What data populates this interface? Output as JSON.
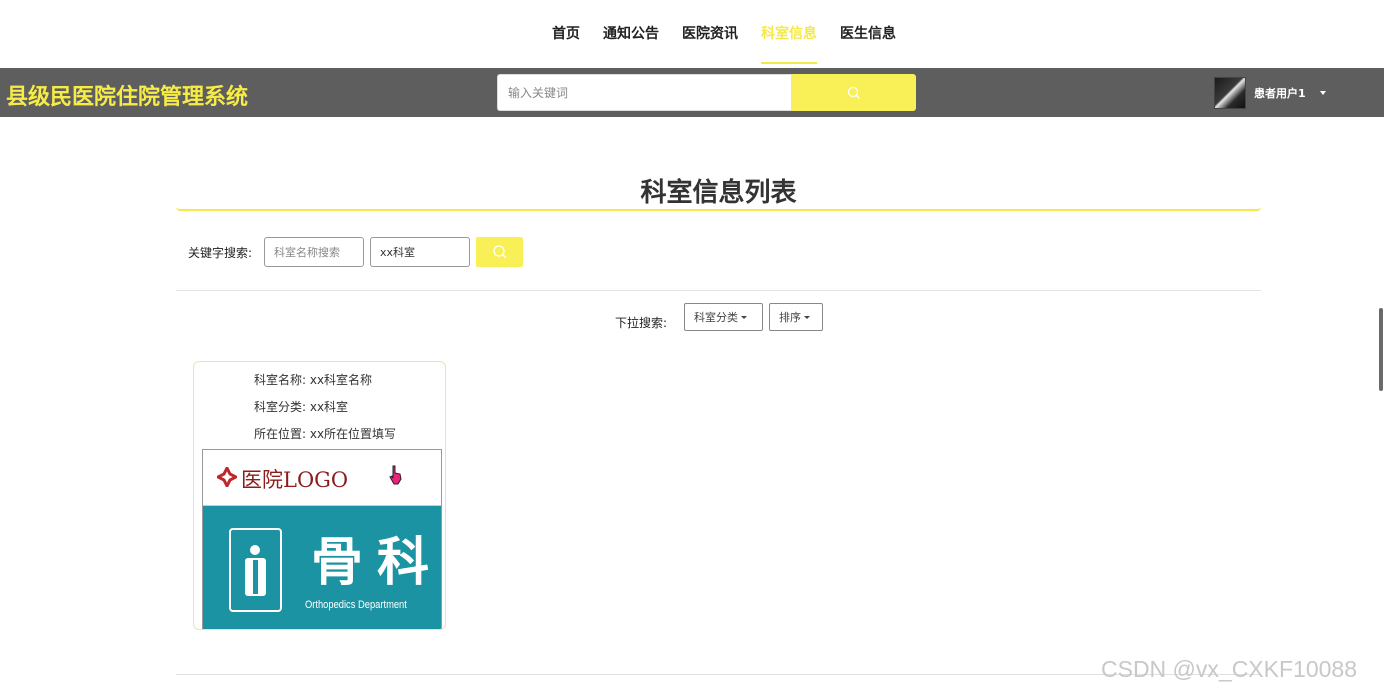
{
  "nav": {
    "items": [
      {
        "label": "首页",
        "active": false
      },
      {
        "label": "通知公告",
        "active": false
      },
      {
        "label": "医院资讯",
        "active": false
      },
      {
        "label": "科室信息",
        "active": true
      },
      {
        "label": "医生信息",
        "active": false
      }
    ]
  },
  "header": {
    "brand": "县级民医院住院管理系统",
    "search_placeholder": "输入关键词",
    "user_name": "患者用户1"
  },
  "page": {
    "title": "科室信息列表"
  },
  "keyword_search": {
    "label": "关键字搜索:",
    "name_placeholder": "科室名称搜索",
    "category_value": "xx科室"
  },
  "dropdown_search": {
    "label": "下拉搜索:",
    "category_button": "科室分类",
    "sort_button": "排序"
  },
  "cards": [
    {
      "name_line": "科室名称: xx科室名称",
      "category_line": "科室分类: xx科室",
      "location_line": "所在位置: xx所在位置填写",
      "image": {
        "logo_text": "医院LOGO",
        "dept_name": "骨科",
        "dept_en": "Orthopedics Department"
      }
    }
  ],
  "watermark": "CSDN @vx_CXKF10088",
  "colors": {
    "accent": "#f7ec46",
    "header_bg": "#5e5e5e",
    "teal": "#1c93a3"
  }
}
